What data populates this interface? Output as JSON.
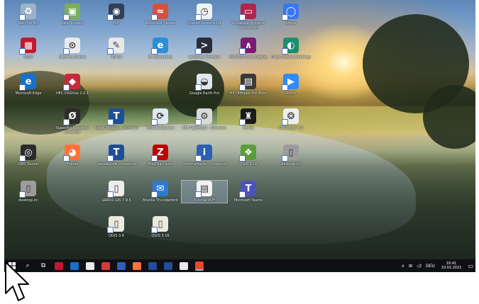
{
  "desktop_icons": [
    {
      "label": "Recycle Bin",
      "color": "#9bb3c9",
      "glyph": "♻"
    },
    {
      "label": "New project",
      "color": "#7cae5b",
      "glyph": "▣"
    },
    {
      "label": "PDF",
      "color": "#2f3f55",
      "glyph": "◉"
    },
    {
      "label": "Waterleaf Viewer",
      "color": "#d4513f",
      "glyph": "≈"
    },
    {
      "label": "ShareX Screenshot",
      "color": "#f2f2f2",
      "glyph": "◷"
    },
    {
      "label": "Screenpal Projects Recordings",
      "color": "#b2264b",
      "glyph": "▭"
    },
    {
      "label": "Signal",
      "color": "#3a76f0",
      "glyph": "◯"
    },
    {
      "label": "QGIS",
      "color": "#c4172e",
      "glyph": "▦"
    },
    {
      "label": "Desmos Online",
      "color": "#eaeaea",
      "glyph": "⊙"
    },
    {
      "label": "PDF24",
      "color": "#e8e8e8",
      "glyph": "✎"
    },
    {
      "label": "IE Alternative",
      "color": "#2b8fd6",
      "glyph": "e"
    },
    {
      "label": "windows Terminal",
      "color": "#2b2d3a",
      "glyph": ">"
    },
    {
      "label": "HYDRUS Data Display",
      "color": "#7a1b76",
      "glyph": "∧"
    },
    {
      "label": "Cisco Webex Meetings",
      "color": "#1a8f6f",
      "glyph": "◐"
    },
    {
      "label": "Microsoft Edge",
      "color": "#1572c9",
      "glyph": "e"
    },
    {
      "label": "HEC-DSSVue 2.0.1",
      "color": "#c72a3a",
      "glyph": "◆"
    },
    {
      "label": "Google Earth Pro",
      "color": "#dfe6ee",
      "glyph": "◒"
    },
    {
      "label": "HP Officejet Pro 8xxx",
      "color": "#3a3a3a",
      "glyph": "▤"
    },
    {
      "label": "Zoom",
      "color": "#2d8cff",
      "glyph": "▶"
    },
    {
      "label": "SuperPro Designer Shortcut",
      "color": "#2d2d2d",
      "glyph": "Ø"
    },
    {
      "label": "EddyDiffusion - Shortcut",
      "color": "#1e4e9a",
      "glyph": "T"
    },
    {
      "label": "MyWaterSphere",
      "color": "#dfe8f3",
      "glyph": "⟳"
    },
    {
      "label": "BMI Optimiser - Shortcut",
      "color": "#d9d9d9",
      "glyph": "⚙"
    },
    {
      "label": "Kindle",
      "color": "#1a1a1a",
      "glyph": "♜"
    },
    {
      "label": "CROPWAT 8.0",
      "color": "#eeeeee",
      "glyph": "❂"
    },
    {
      "label": "OBS Studio",
      "color": "#2b2b2b",
      "glyph": "◎"
    },
    {
      "label": "Firefox",
      "color": "#ff7139",
      "glyph": "◕"
    },
    {
      "label": "SaveNGrow - Shortcut",
      "color": "#1e4e9a",
      "glyph": "T"
    },
    {
      "label": "FileZilla Client",
      "color": "#bf0000",
      "glyph": "Z"
    },
    {
      "label": "Informationen - Shortcut",
      "color": "#2c5fb0",
      "glyph": "i"
    },
    {
      "label": "QGIS 3.16",
      "color": "#5b9d3b",
      "glyph": "❖"
    },
    {
      "label": "desktop.ini",
      "color": "#9c9c9c",
      "glyph": "▯"
    },
    {
      "label": "desktop.ini",
      "color": "#9c9c9c",
      "glyph": "▯"
    },
    {
      "label": "GRASS GIS 7.8.5",
      "color": "#ededed",
      "glyph": "▯"
    },
    {
      "label": "Mozilla Thunderbird",
      "color": "#2f7bd2",
      "glyph": "✉"
    },
    {
      "label": "Tutorial PDF",
      "color": "#f1f1f1",
      "glyph": "▤"
    },
    {
      "label": "Microsoft Teams",
      "color": "#4b53bc",
      "glyph": "T"
    },
    {
      "label": "QGIS 3.6",
      "color": "#eceadf",
      "glyph": "▯"
    },
    {
      "label": "QGIS 3.16",
      "color": "#eceadf",
      "glyph": "▯"
    }
  ],
  "taskbar": {
    "start_icon": "windows-start-icon",
    "search_glyph": "⌕",
    "taskview_glyph": "⧉",
    "apps": [
      {
        "name": "pdf-reader",
        "color": "#c4172e"
      },
      {
        "name": "mail",
        "color": "#1572c9"
      },
      {
        "name": "chrome",
        "color": "#e9e9e9"
      },
      {
        "name": "zoom-tool",
        "color": "#d43a3a"
      },
      {
        "name": "word",
        "color": "#2b5fb8"
      },
      {
        "name": "firefox",
        "color": "#ff7139"
      },
      {
        "name": "edd",
        "color": "#1e4e9a"
      },
      {
        "name": "savengrow",
        "color": "#1e4e9a"
      },
      {
        "name": "chrome-alt",
        "color": "#e9e9e9"
      },
      {
        "name": "app-red",
        "color": "#e24a2a"
      }
    ],
    "tray_up": "∧",
    "tray_net": "⊞",
    "tray_vol": "◁)",
    "language": "DEU",
    "time": "16:41",
    "date": "10.02.2021",
    "notification_glyph": "▭"
  }
}
